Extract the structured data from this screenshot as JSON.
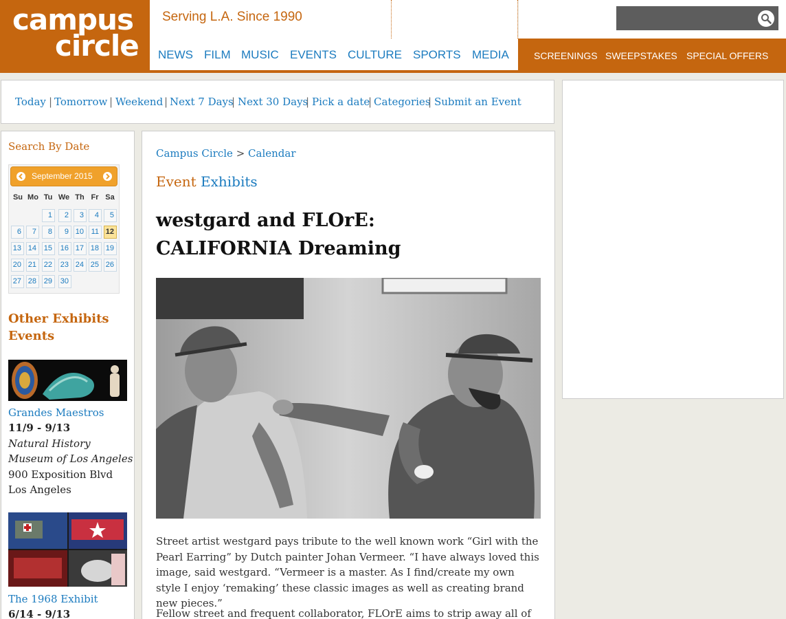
{
  "header": {
    "logo_line1": "campus",
    "logo_line2": "circle",
    "tagline": "Serving L.A. Since 1990",
    "search_placeholder": "",
    "nav": [
      "NEWS",
      "FILM",
      "MUSIC",
      "EVENTS",
      "CULTURE",
      "SPORTS",
      "MEDIA"
    ],
    "promo": [
      "SCREENINGS",
      "SWEEPSTAKES",
      "SPECIAL OFFERS"
    ]
  },
  "datebar": {
    "links": [
      "Today",
      "Tomorrow",
      "Weekend",
      "Next 7 Days",
      "Next 30 Days",
      "Pick a date",
      "Categories",
      "Submit an Event"
    ],
    "separator": "|"
  },
  "sidebar": {
    "search_by_date": "Search By Date",
    "calendar": {
      "month_label": "September 2015",
      "weekdays": [
        "Su",
        "Mo",
        "Tu",
        "We",
        "Th",
        "Fr",
        "Sa"
      ],
      "days": [
        "1",
        "2",
        "3",
        "4",
        "5",
        "6",
        "7",
        "8",
        "9",
        "10",
        "11",
        "12",
        "13",
        "14",
        "15",
        "16",
        "17",
        "18",
        "19",
        "20",
        "21",
        "22",
        "23",
        "24",
        "25",
        "26",
        "27",
        "28",
        "29",
        "30"
      ],
      "today": "12"
    },
    "other_title": "Other Exhibits Events",
    "events": [
      {
        "name": "Grandes Maestros",
        "dates": "11/9 - 9/13",
        "venue_line1": "Natural History",
        "venue_line2": "Museum of Los Angeles",
        "address_line1": "900 Exposition Blvd",
        "address_line2": "Los Angeles"
      },
      {
        "name": "The 1968 Exhibit",
        "dates": "6/14 - 9/13"
      }
    ]
  },
  "main": {
    "breadcrumb": {
      "home": "Campus Circle",
      "sep": ">",
      "current": "Calendar"
    },
    "event_word": "Event",
    "category": "Exhibits",
    "title": "westgard and FLOrE: CALIFORNIA Dreaming",
    "paragraphs": [
      "Street artist westgard pays tribute to the well known work “Girl with the Pearl Earring” by Dutch painter Johan Vermeer. “I have always loved this image, said westgard. “Vermeer is a master. As I find/create my own style I enjoy ‘remaking’ these classic images as well as creating brand new pieces.”",
      "Fellow street and frequent collaborator, FLOrE aims to strip away all of the"
    ]
  },
  "colors": {
    "brand_orange": "#c5660f",
    "link_blue": "#1b7bbf",
    "calendar_header": "#f0a12b",
    "page_background": "#ecebe4"
  },
  "icons": {
    "search": "search-icon",
    "prev": "arrow-left-icon",
    "next": "arrow-right-icon"
  }
}
